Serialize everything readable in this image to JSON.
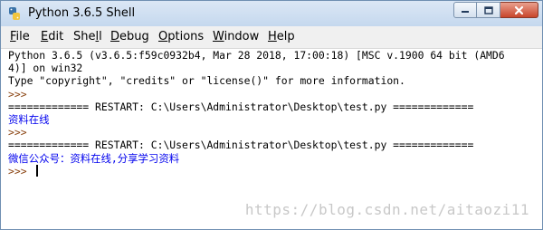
{
  "window": {
    "title": "Python 3.6.5 Shell"
  },
  "menubar": {
    "items": [
      {
        "label_pre": "",
        "accel": "F",
        "label_post": "ile"
      },
      {
        "label_pre": "",
        "accel": "E",
        "label_post": "dit"
      },
      {
        "label_pre": "She",
        "accel": "l",
        "label_post": "l"
      },
      {
        "label_pre": "",
        "accel": "D",
        "label_post": "ebug"
      },
      {
        "label_pre": "",
        "accel": "O",
        "label_post": "ptions"
      },
      {
        "label_pre": "",
        "accel": "W",
        "label_post": "indow"
      },
      {
        "label_pre": "",
        "accel": "H",
        "label_post": "elp"
      }
    ]
  },
  "shell": {
    "lines": [
      "Python 3.6.5 (v3.6.5:f59c0932b4, Mar 28 2018, 17:00:18) [MSC v.1900 64 bit (AMD6",
      "4)] on win32",
      "Type \"copyright\", \"credits\" or \"license()\" for more information.",
      ">>> ",
      "============= RESTART: C:\\Users\\Administrator\\Desktop\\test.py =============",
      "资料在线",
      ">>> ",
      "============= RESTART: C:\\Users\\Administrator\\Desktop\\test.py =============",
      "微信公众号：资料在线,分享学习资料",
      ">>> "
    ]
  },
  "watermark": "https://blog.csdn.net/aitaozi11",
  "colors": {
    "prompt": "#8b4513",
    "output": "#0000ee",
    "titlebar": "#c5d8ee",
    "close_button": "#c8452b"
  }
}
